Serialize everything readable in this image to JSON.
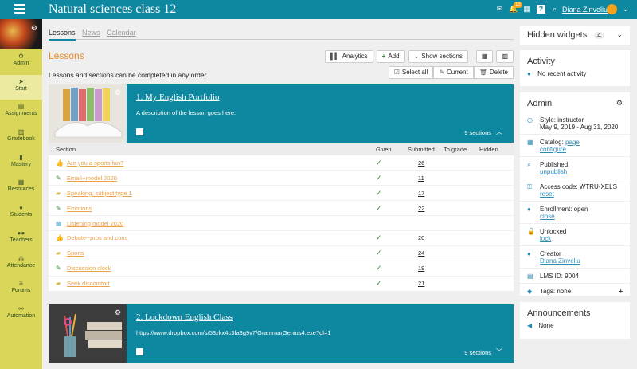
{
  "app": {
    "title": "Natural sciences class 12",
    "notification_count": "13",
    "user_name": "Diana Zinveliu"
  },
  "sidebar": {
    "items": [
      {
        "label": "Admin",
        "icon": "gear-icon"
      },
      {
        "label": "Start",
        "icon": "arrow-icon"
      },
      {
        "label": "Assignments",
        "icon": "clipboard-icon"
      },
      {
        "label": "Gradebook",
        "icon": "book-icon"
      },
      {
        "label": "Mastery",
        "icon": "bars-icon"
      },
      {
        "label": "Resources",
        "icon": "grid-icon"
      },
      {
        "label": "Students",
        "icon": "person-icon"
      },
      {
        "label": "Teachers",
        "icon": "people-icon"
      },
      {
        "label": "Attendance",
        "icon": "group-icon"
      },
      {
        "label": "Forums",
        "icon": "list-icon"
      },
      {
        "label": "Automation",
        "icon": "link-icon"
      }
    ],
    "active": "Start"
  },
  "main": {
    "tabs": [
      "Lessons",
      "News",
      "Calendar"
    ],
    "heading": "Lessons",
    "buttons": {
      "analytics": "Analytics",
      "add": "Add",
      "show_sections": "Show sections"
    },
    "note": "Lessons and sections can be completed in any order.",
    "select_buttons": {
      "select_all": "Select all",
      "current": "Current",
      "delete": "Delete"
    }
  },
  "lessons": [
    {
      "title": "1. My English Portfolio",
      "description": "A description of the lesson goes here.",
      "sections_count": "9 sections",
      "columns": [
        "Section",
        "Given",
        "Submitted",
        "To grade",
        "Hidden"
      ],
      "sections": [
        {
          "name": "Are you a sports fan?",
          "icon": "thumbs-up-icon",
          "given": true,
          "submitted": "26"
        },
        {
          "name": "Email--model 2020",
          "icon": "pencil-icon",
          "given": true,
          "submitted": "11"
        },
        {
          "name": "Speaking, subject type 1",
          "icon": "speech-bubble-icon",
          "given": true,
          "submitted": "17"
        },
        {
          "name": "Emotions",
          "icon": "pencil-icon",
          "given": true,
          "submitted": "22"
        },
        {
          "name": "Listening model 2020",
          "icon": "document-icon",
          "given": false,
          "submitted": ""
        },
        {
          "name": "Debate--pros and cons",
          "icon": "thumbs-up-icon",
          "given": true,
          "submitted": "20"
        },
        {
          "name": "Sports",
          "icon": "speech-bubble-icon",
          "given": true,
          "submitted": "24"
        },
        {
          "name": "Discussion clock",
          "icon": "pencil-icon",
          "given": true,
          "submitted": "19"
        },
        {
          "name": "Seek discomfort",
          "icon": "speech-bubble-icon",
          "given": true,
          "submitted": "21"
        }
      ]
    },
    {
      "title": "2. Lockdown English Class",
      "description": "https://www.dropbox.com/s/53zkx4c3fa3g9v7/GrammarGenius4.exe?dl=1",
      "sections_count": "9 sections"
    }
  ],
  "right": {
    "hidden_widgets": {
      "label": "Hidden widgets",
      "count": "4"
    },
    "activity": {
      "title": "Activity",
      "text": "No recent activity"
    },
    "admin": {
      "title": "Admin",
      "rows": [
        {
          "icon": "clock-icon",
          "text": "Style: instructor",
          "sub": "May 9, 2019 - Aug 31, 2020"
        },
        {
          "icon": "catalog-icon",
          "text": "Catalog:",
          "link_inline": "page",
          "link": "configure"
        },
        {
          "icon": "search-icon",
          "text": "Published",
          "link": "unpublish"
        },
        {
          "icon": "key-icon",
          "text": "Access code: WTRU-XELS",
          "link": "reset"
        },
        {
          "icon": "people-icon",
          "text": "Enrollment: open",
          "link": "close"
        },
        {
          "icon": "unlock-icon",
          "text": "Unlocked",
          "link": "lock"
        },
        {
          "icon": "person-icon",
          "text": "Creator",
          "link": "Diana Zinveliu"
        },
        {
          "icon": "books-icon",
          "text": "LMS ID: 9004"
        },
        {
          "icon": "tag-icon",
          "text": "Tags: none"
        }
      ]
    },
    "announcements": {
      "title": "Announcements",
      "text": "None"
    }
  },
  "colors": {
    "brand": "#0e87a0",
    "sidebar": "#d9d65a",
    "accent": "#e8892a"
  }
}
